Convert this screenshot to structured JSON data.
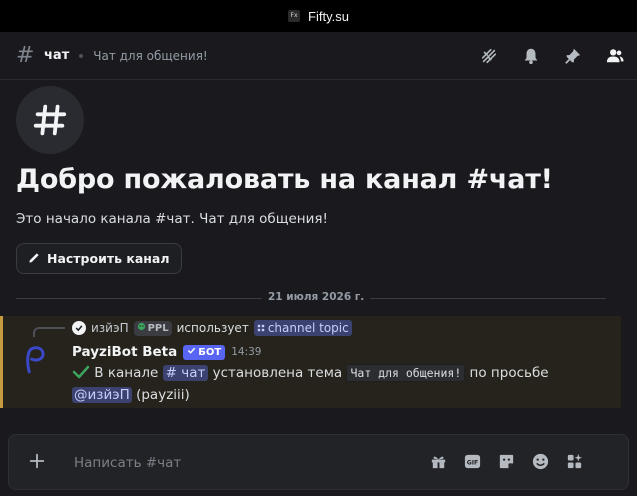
{
  "window": {
    "title": "Fifty.su",
    "favicon_text": "Fx"
  },
  "header": {
    "channel_name": "чат",
    "channel_topic": "Чат для общения!",
    "tools": [
      "threads-icon",
      "bell-icon",
      "pin-icon",
      "members-icon"
    ]
  },
  "welcome": {
    "title": "Добро пожаловать на канал #чат!",
    "subtitle": "Это начало канала #чат. Чат для общения!",
    "setup_button": "Настроить канал"
  },
  "divider": {
    "date": "21 июля 2026 г."
  },
  "message": {
    "reply": {
      "user": "изйэП",
      "tag": "PPL",
      "action": "использует",
      "command": "channel topic"
    },
    "author": "PayziBot Beta",
    "badge": "БОТ",
    "time": "14:39",
    "body": {
      "prefix": "В канале",
      "channel_mention": "# чат",
      "middle": "установлена тема",
      "topic_code": "Чат для общения!",
      "suffix": "по просьбе",
      "user_mention": "@изйэП",
      "username": "(payziii)"
    }
  },
  "composer": {
    "placeholder": "Написать #чат",
    "tools": [
      "gift-icon",
      "gif-icon",
      "sticker-icon",
      "emoji-icon",
      "apps-icon"
    ]
  },
  "colors": {
    "accent": "#5865f2",
    "highlight_border": "#c69a3f",
    "background": "#1a1a1e"
  }
}
